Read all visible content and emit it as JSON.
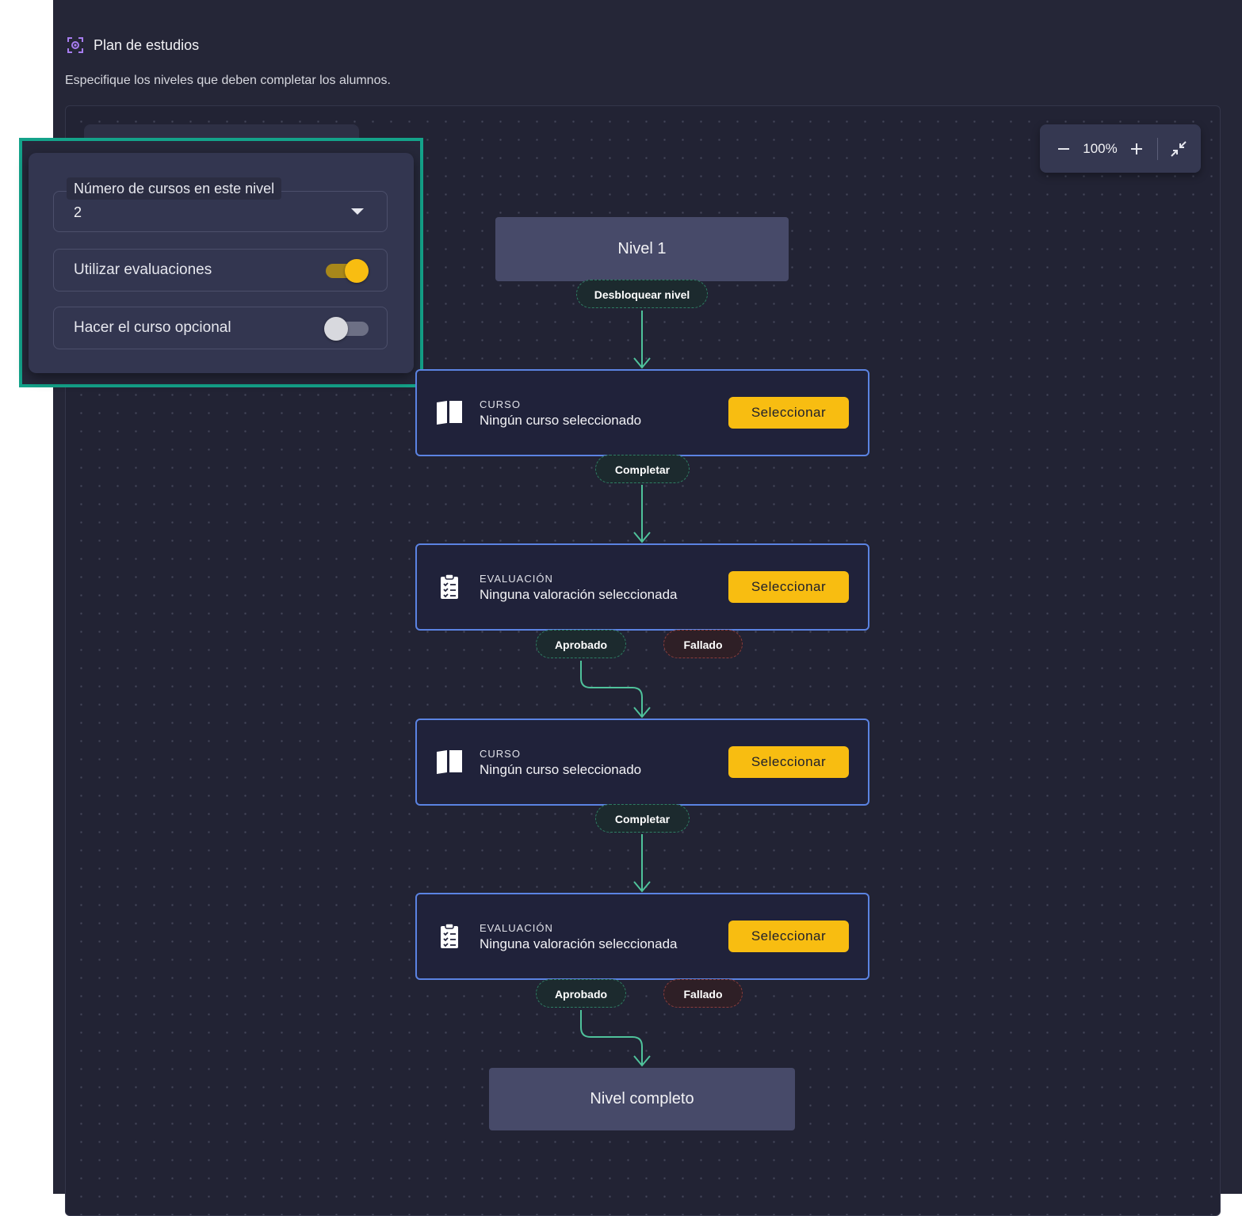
{
  "section": {
    "title": "Plan de estudios",
    "subtitle": "Especifique los niveles que deben completar los alumnos."
  },
  "zoom": {
    "value": "100%"
  },
  "settings": {
    "courses_count_label": "Número de cursos en este nivel",
    "courses_count_value": "2",
    "use_evaluations_label": "Utilizar evaluaciones",
    "use_evaluations_on": true,
    "optional_course_label": "Hacer el curso opcional",
    "optional_course_on": false
  },
  "flow": {
    "level_title": "Nivel 1",
    "unlock_label": "Desbloquear nivel",
    "complete_label": "Completar",
    "passed_label": "Aprobado",
    "failed_label": "Fallado",
    "level_complete": "Nivel completo",
    "nodes": [
      {
        "type": "CURSO",
        "text": "Ningún curso seleccionado",
        "button": "Seleccionar",
        "icon": "book-icon"
      },
      {
        "type": "EVALUACIÓN",
        "text": "Ninguna valoración seleccionada",
        "button": "Seleccionar",
        "icon": "clipboard-icon"
      },
      {
        "type": "CURSO",
        "text": "Ningún curso seleccionado",
        "button": "Seleccionar",
        "icon": "book-icon"
      },
      {
        "type": "EVALUACIÓN",
        "text": "Ninguna valoración seleccionada",
        "button": "Seleccionar",
        "icon": "clipboard-icon"
      }
    ]
  },
  "colors": {
    "accent": "#f8bd11",
    "node_border": "#5b83e2",
    "connector": "#4fc29b",
    "highlight": "#14a38a",
    "background": "#252637"
  }
}
